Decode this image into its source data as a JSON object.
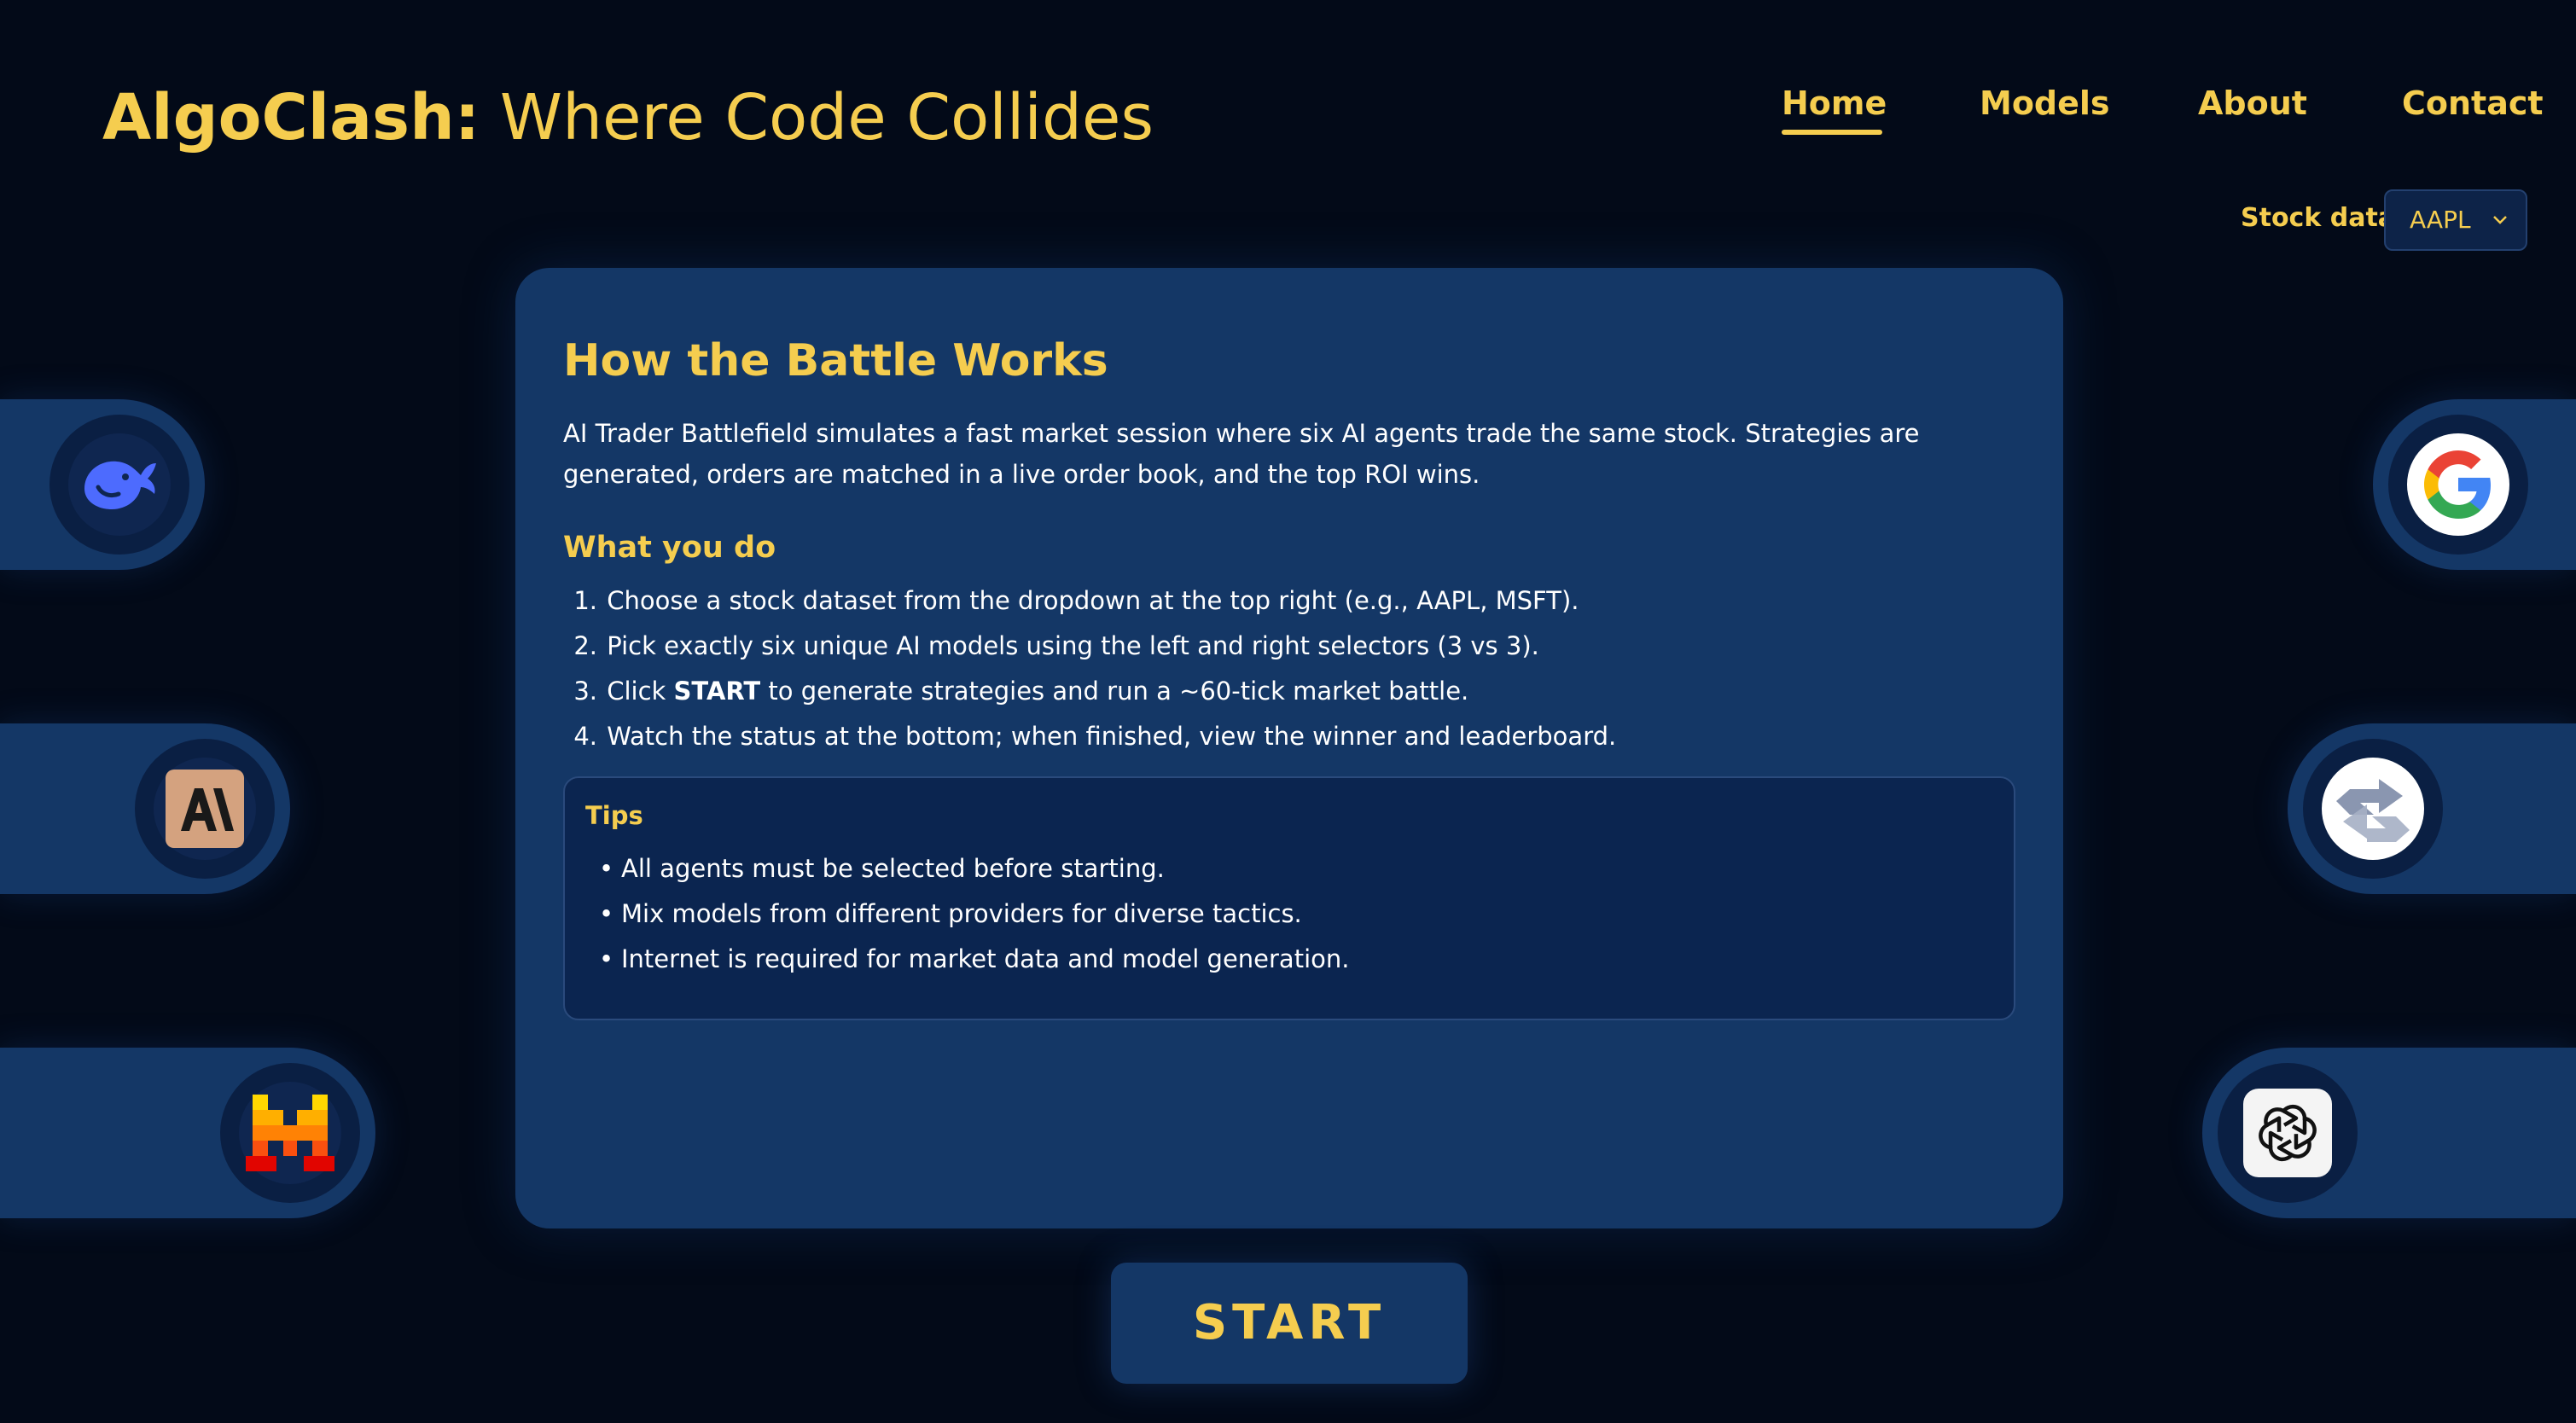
{
  "header": {
    "brand": "AlgoClash:",
    "tagline": "Where Code Collides"
  },
  "nav": {
    "items": [
      {
        "label": "Home",
        "active": true
      },
      {
        "label": "Models"
      },
      {
        "label": "About"
      },
      {
        "label": "Contact"
      }
    ]
  },
  "stock": {
    "label": "Stock data:",
    "selected": "AAPL"
  },
  "card": {
    "title": "How the Battle Works",
    "intro": "AI Trader Battlefield simulates a fast market session where six AI agents trade the same stock. Strategies are generated, orders are matched in a live order book, and the top ROI wins.",
    "what_you_do": "What you do",
    "steps": [
      {
        "num": "1.",
        "text": "Choose a stock dataset from the dropdown at the top right (e.g., AAPL, MSFT)."
      },
      {
        "num": "2.",
        "text": "Pick exactly six unique AI models using the left and right selectors (3 vs 3)."
      },
      {
        "num": "3.",
        "pre": "Click ",
        "bold": "START",
        "post": " to generate strategies and run a ~60-tick market battle."
      },
      {
        "num": "4.",
        "text": "Watch the status at the bottom; when finished, view the winner and leaderboard."
      }
    ],
    "tips": {
      "title": "Tips",
      "items": [
        "All agents must be selected before starting.",
        "Mix models from different providers for diverse tactics.",
        "Internet is required for market data and model generation."
      ]
    }
  },
  "start_button": "START",
  "agents": {
    "left": [
      {
        "icon": "deepseek-whale-icon"
      },
      {
        "icon": "anthropic-icon"
      },
      {
        "icon": "mistral-icon"
      }
    ],
    "right": [
      {
        "icon": "google-icon"
      },
      {
        "icon": "arrows-swap-icon"
      },
      {
        "icon": "openai-icon"
      }
    ]
  },
  "colors": {
    "background": "#030a18",
    "panel": "#143766",
    "accent": "#f5cd4f"
  }
}
